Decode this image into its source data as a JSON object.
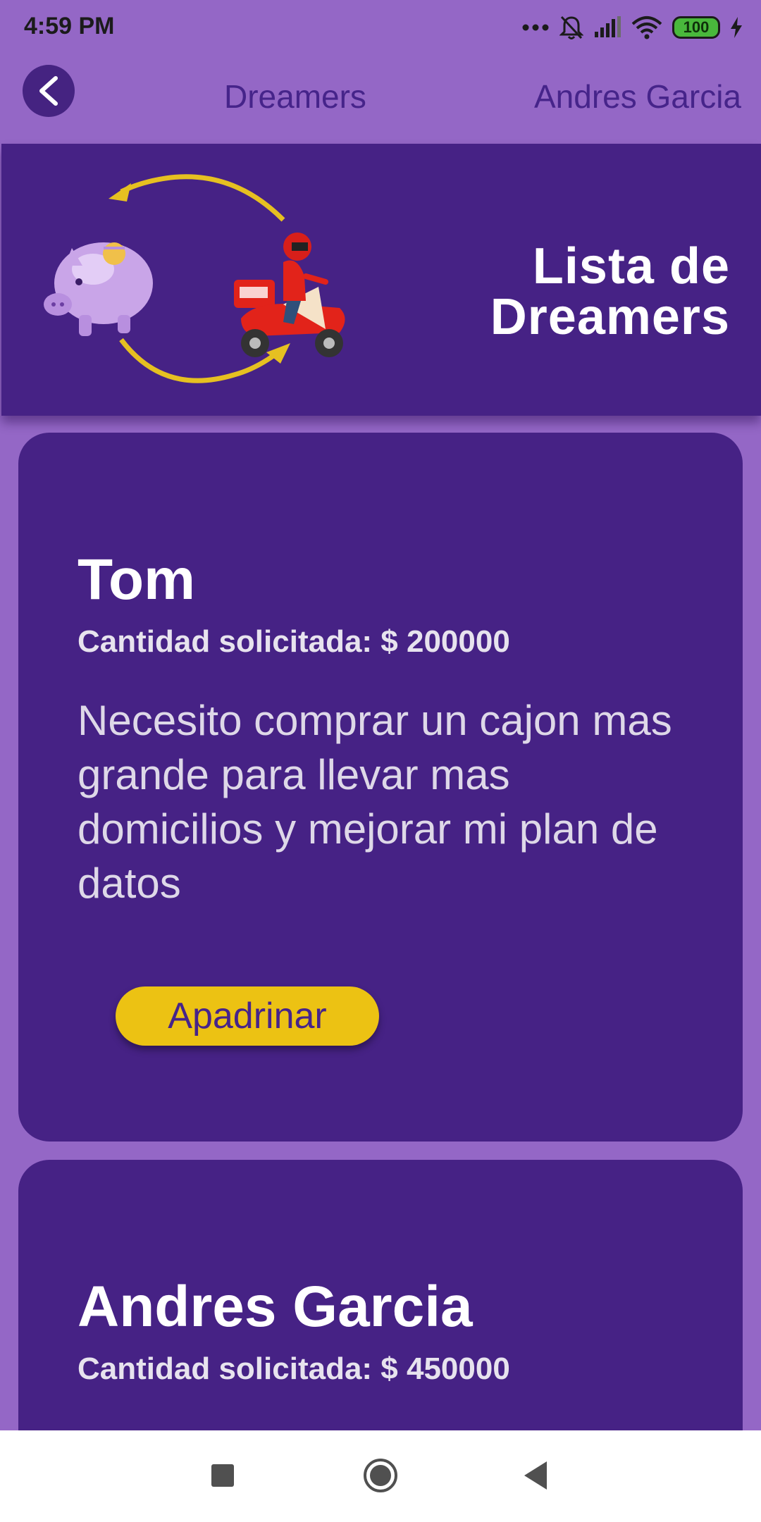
{
  "status_bar": {
    "time": "4:59 PM",
    "battery_level": "100",
    "icons": [
      "more-dots-icon",
      "bell-off-icon",
      "signal-icon",
      "wifi-icon",
      "battery-icon",
      "charging-icon"
    ]
  },
  "app_bar": {
    "title": "Dreamers",
    "user": "Andres Garcia",
    "back_icon": "chevron-left-icon"
  },
  "banner": {
    "title_line1": "Lista de",
    "title_line2": "Dreamers",
    "illustration": [
      "piggy-bank-icon",
      "cycle-arrows-icon",
      "delivery-scooter-icon"
    ]
  },
  "dreamers": [
    {
      "name": "Tom",
      "amount": "Cantidad solicitada: $ 200000",
      "description": "Necesito comprar un cajon mas grande para llevar mas domicilios y mejorar mi plan de datos",
      "action": "Apadrinar"
    },
    {
      "name": "Andres Garcia",
      "amount": "Cantidad solicitada: $ 450000"
    }
  ],
  "colors": {
    "background": "#9467c6",
    "primary": "#462285",
    "accent": "#ecc213"
  },
  "nav_bar": {
    "icons": [
      "recent-apps-icon",
      "home-icon",
      "back-triangle-icon"
    ]
  }
}
